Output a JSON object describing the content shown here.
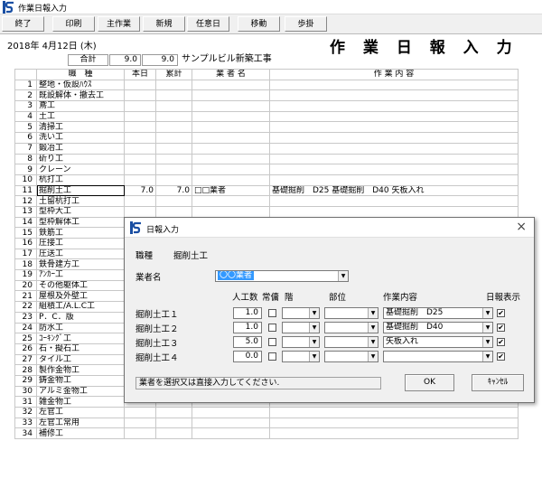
{
  "window": {
    "title": "作業日報入力"
  },
  "toolbar": [
    {
      "id": "end",
      "label": "終了"
    },
    {
      "id": "print",
      "label": "印刷"
    },
    {
      "id": "main-work",
      "label": "主作業"
    },
    {
      "id": "new",
      "label": "新規"
    },
    {
      "id": "any-day",
      "label": "任意日"
    },
    {
      "id": "move",
      "label": "移動"
    },
    {
      "id": "walk",
      "label": "歩掛"
    }
  ],
  "header": {
    "date": "2018年 4月12日 (木)",
    "page_title": "作 業 日 報 入 力",
    "total_label": "合計",
    "total_today": "9.0",
    "total_cumulative": "9.0",
    "site_name": "サンプルビル新築工事"
  },
  "grid": {
    "columns": [
      "職　種",
      "本日",
      "累計",
      "業 者 名",
      "作 業 内 容"
    ],
    "rows": [
      {
        "no": "1",
        "kind": "整地・仮設ﾊｳｽ",
        "today": "",
        "cum": "",
        "company": "",
        "work": ""
      },
      {
        "no": "2",
        "kind": "既設解体・撤去工",
        "today": "",
        "cum": "",
        "company": "",
        "work": ""
      },
      {
        "no": "3",
        "kind": "鳶工",
        "today": "",
        "cum": "",
        "company": "",
        "work": ""
      },
      {
        "no": "4",
        "kind": "土工",
        "today": "",
        "cum": "",
        "company": "",
        "work": ""
      },
      {
        "no": "5",
        "kind": "清掃工",
        "today": "",
        "cum": "",
        "company": "",
        "work": ""
      },
      {
        "no": "6",
        "kind": "洗い工",
        "today": "",
        "cum": "",
        "company": "",
        "work": ""
      },
      {
        "no": "7",
        "kind": "鍛冶工",
        "today": "",
        "cum": "",
        "company": "",
        "work": ""
      },
      {
        "no": "8",
        "kind": "斫り工",
        "today": "",
        "cum": "",
        "company": "",
        "work": ""
      },
      {
        "no": "9",
        "kind": "クレーン",
        "today": "",
        "cum": "",
        "company": "",
        "work": ""
      },
      {
        "no": "10",
        "kind": "杭打工",
        "today": "",
        "cum": "",
        "company": "",
        "work": ""
      },
      {
        "no": "11",
        "kind": "掘削土工",
        "today": "7.0",
        "cum": "7.0",
        "company": "□□業者",
        "work": "基礎掘削　D25 基礎掘削　D40 矢板入れ"
      },
      {
        "no": "12",
        "kind": "土留杭打工",
        "today": "",
        "cum": "",
        "company": "",
        "work": ""
      },
      {
        "no": "13",
        "kind": "型枠大工",
        "today": "",
        "cum": "",
        "company": "",
        "work": ""
      },
      {
        "no": "14",
        "kind": "型枠解体工",
        "today": "",
        "cum": "",
        "company": "",
        "work": ""
      },
      {
        "no": "15",
        "kind": "鉄筋工",
        "today": "",
        "cum": "",
        "company": "",
        "work": ""
      },
      {
        "no": "16",
        "kind": "圧接工",
        "today": "",
        "cum": "",
        "company": "",
        "work": ""
      },
      {
        "no": "17",
        "kind": "圧送工",
        "today": "",
        "cum": "",
        "company": "",
        "work": ""
      },
      {
        "no": "18",
        "kind": "鉄骨建方工",
        "today": "",
        "cum": "",
        "company": "",
        "work": ""
      },
      {
        "no": "19",
        "kind": "ｱﾝｶｰ工",
        "today": "",
        "cum": "",
        "company": "",
        "work": ""
      },
      {
        "no": "20",
        "kind": "その他躯体工",
        "today": "",
        "cum": "",
        "company": "",
        "work": ""
      },
      {
        "no": "21",
        "kind": "屋根及外壁工",
        "today": "",
        "cum": "",
        "company": "",
        "work": ""
      },
      {
        "no": "22",
        "kind": "組積工/A.L.C工",
        "today": "",
        "cum": "",
        "company": "",
        "work": ""
      },
      {
        "no": "23",
        "kind": "P．C．版",
        "today": "",
        "cum": "",
        "company": "",
        "work": ""
      },
      {
        "no": "24",
        "kind": "防水工",
        "today": "",
        "cum": "",
        "company": "",
        "work": ""
      },
      {
        "no": "25",
        "kind": "ｺｰｷﾝｸﾞ工",
        "today": "",
        "cum": "",
        "company": "",
        "work": ""
      },
      {
        "no": "26",
        "kind": "石・擬石工",
        "today": "",
        "cum": "",
        "company": "",
        "work": ""
      },
      {
        "no": "27",
        "kind": "タイル工",
        "today": "",
        "cum": "",
        "company": "",
        "work": ""
      },
      {
        "no": "28",
        "kind": "製作金物工",
        "today": "",
        "cum": "",
        "company": "",
        "work": ""
      },
      {
        "no": "29",
        "kind": "鋳金物工",
        "today": "",
        "cum": "",
        "company": "",
        "work": ""
      },
      {
        "no": "30",
        "kind": "アルミ金物工",
        "today": "",
        "cum": "",
        "company": "",
        "work": ""
      },
      {
        "no": "31",
        "kind": "雑金物工",
        "today": "",
        "cum": "",
        "company": "",
        "work": ""
      },
      {
        "no": "32",
        "kind": "左官工",
        "today": "",
        "cum": "",
        "company": "",
        "work": ""
      },
      {
        "no": "33",
        "kind": "左官工常用",
        "today": "",
        "cum": "",
        "company": "",
        "work": ""
      },
      {
        "no": "34",
        "kind": "補修工",
        "today": "",
        "cum": "",
        "company": "",
        "work": ""
      }
    ]
  },
  "dialog": {
    "title": "日報入力",
    "close": "×",
    "kind_label": "職種",
    "kind_value": "掘削土工",
    "company_label": "業者名",
    "company_value": "〇〇業者",
    "col_headers": {
      "man_days": "人工数",
      "regular": "常傭",
      "floor": "階",
      "part": "部位",
      "work": "作業内容",
      "show": "日報表示"
    },
    "lines": [
      {
        "name": "掘削土工１",
        "man_days": "1.0",
        "regular": false,
        "floor": "",
        "part": "",
        "work": "基礎掘削　D25",
        "show": true
      },
      {
        "name": "掘削土工２",
        "man_days": "1.0",
        "regular": false,
        "floor": "",
        "part": "",
        "work": "基礎掘削　D40",
        "show": true
      },
      {
        "name": "掘削土工３",
        "man_days": "5.0",
        "regular": false,
        "floor": "",
        "part": "",
        "work": "矢板入れ",
        "show": true
      },
      {
        "name": "掘削土工４",
        "man_days": "0.0",
        "regular": false,
        "floor": "",
        "part": "",
        "work": "",
        "show": true
      }
    ],
    "status": "業者を選択又は直接入力してください.",
    "ok": "OK",
    "cancel": "ｷｬﾝｾﾙ"
  }
}
